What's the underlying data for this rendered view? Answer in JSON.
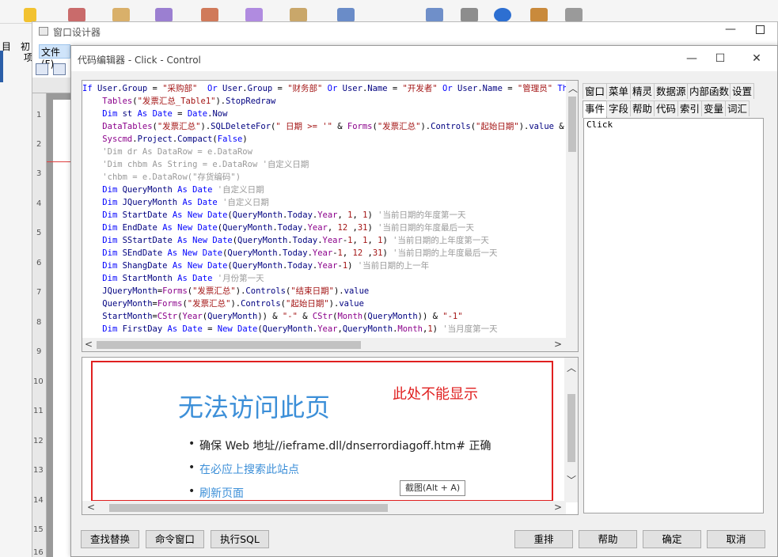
{
  "background_app": {
    "left_labels": [
      "目",
      "初",
      "项"
    ]
  },
  "designer": {
    "title": "窗口设计器",
    "menu_file": "文件(F)",
    "ruler_numbers": [
      "1",
      "2",
      "3",
      "4",
      "5",
      "6",
      "7",
      "8",
      "9",
      "10",
      "11",
      "12",
      "13",
      "14",
      "15",
      "16"
    ]
  },
  "editor": {
    "title": "代码编辑器 - Click - Control",
    "code_lines": [
      "If User.Group = \"采购部\"  Or User.Group = \"财务部\" Or User.Name = \"开发者\" Or User.Name = \"管理员\" Th",
      "    Tables(\"发票汇总_Table1\").StopRedraw",
      "    Dim st As Date = Date.Now",
      "    DataTables(\"发票汇总\").SQLDeleteFor(\" 日期 >= '\" & Forms(\"发票汇总\").Controls(\"起始日期\").value &",
      "    Syscmd.Project.Compact(False)",
      "    'Dim dr As DataRow = e.DataRow",
      "    'Dim chbm As String = e.DataRow '自定义日期",
      "    'chbm = e.DataRow(\"存货编码\")",
      "    Dim QueryMonth As Date '自定义日期",
      "    Dim JQueryMonth As Date '自定义日期",
      "    Dim StartDate As New Date(QueryMonth.Today.Year, 1, 1) '当前日期的年度第一天",
      "    Dim EndDate As New Date(QueryMonth.Today.Year, 12 ,31) '当前日期的年度最后一天",
      "    Dim SStartDate As New Date(QueryMonth.Today.Year-1, 1, 1) '当前日期的上年度第一天",
      "    Dim SEndDate As New Date(QueryMonth.Today.Year-1, 12 ,31) '当前日期的上年度最后一天",
      "    Dim ShangDate As New Date(QueryMonth.Today.Year-1) '当前日期的上一年",
      "    Dim StartMonth As Date '月份第一天",
      "    JQueryMonth=Forms(\"发票汇总\").Controls(\"结束日期\").value",
      "    QueryMonth=Forms(\"发票汇总\").Controls(\"起始日期\").value",
      "    StartMonth=CStr(Year(QueryMonth)) & \"-\" & CStr(Month(QueryMonth)) & \"-1\"",
      "    Dim FirstDay As Date = New Date(QueryMonth.Year,QueryMonth.Month,1) '当月度第一天"
    ],
    "browser": {
      "error_title": "无法访问此页",
      "annotation": "此处不能显示",
      "items": [
        "确保 Web 地址//ieframe.dll/dnserrordiagoff.htm# 正确",
        "在必应上搜索此站点",
        "刷新页面"
      ],
      "tooltip": "截图(Alt + A)"
    },
    "tabs_row1": [
      "窗口",
      "菜单",
      "精灵",
      "数据源",
      "内部函数",
      "设置"
    ],
    "tabs_row2": [
      "事件",
      "字段",
      "帮助",
      "代码",
      "索引",
      "变量",
      "词汇"
    ],
    "active_tab": "事件",
    "event_list": [
      "Click"
    ],
    "buttons": {
      "find_replace": "查找替换",
      "command_window": "命令窗口",
      "exec_sql": "执行SQL",
      "rearrange": "重排",
      "help": "帮助",
      "ok": "确定",
      "cancel": "取消"
    },
    "window_controls": {
      "minimize": "—",
      "maximize": "☐",
      "close": "✕"
    }
  }
}
